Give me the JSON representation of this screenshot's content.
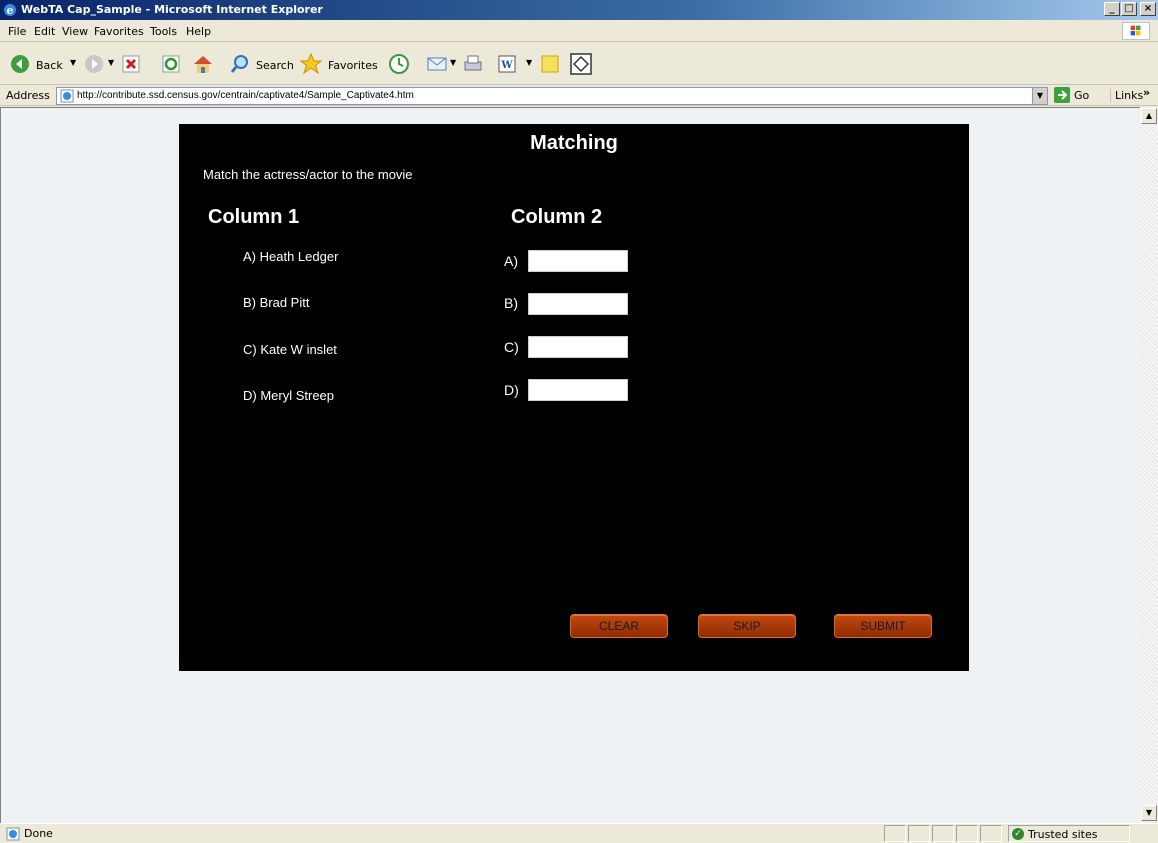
{
  "window": {
    "title": "WebTA Cap_Sample - Microsoft Internet Explorer",
    "controls": [
      "_",
      "□",
      "×"
    ]
  },
  "menubar": {
    "items": [
      "File",
      "Edit",
      "View",
      "Favorites",
      "Tools",
      "Help"
    ]
  },
  "toolbar": {
    "back_label": "Back",
    "search_label": "Search",
    "favorites_label": "Favorites"
  },
  "address": {
    "label": "Address",
    "url": "http://contribute.ssd.census.gov/centrain/captivate4/Sample_Captivate4.htm",
    "go_label": "Go",
    "links_label": "Links"
  },
  "quiz": {
    "title": "Matching",
    "instruction": "Match the actress/actor to the movie",
    "column1_header": "Column 1",
    "column2_header": "Column 2",
    "column1_items": [
      "A) Heath Ledger",
      "B) Brad Pitt",
      "C) Kate W inslet",
      "D) Meryl Streep"
    ],
    "column2_labels": [
      "A)",
      "B)",
      "C)",
      "D)"
    ],
    "answers": [
      "",
      "",
      "",
      ""
    ],
    "buttons": {
      "clear": "CLEAR",
      "skip": "SKIP",
      "submit": "SUBMIT"
    }
  },
  "statusbar": {
    "status": "Done",
    "zone": "Trusted sites"
  }
}
